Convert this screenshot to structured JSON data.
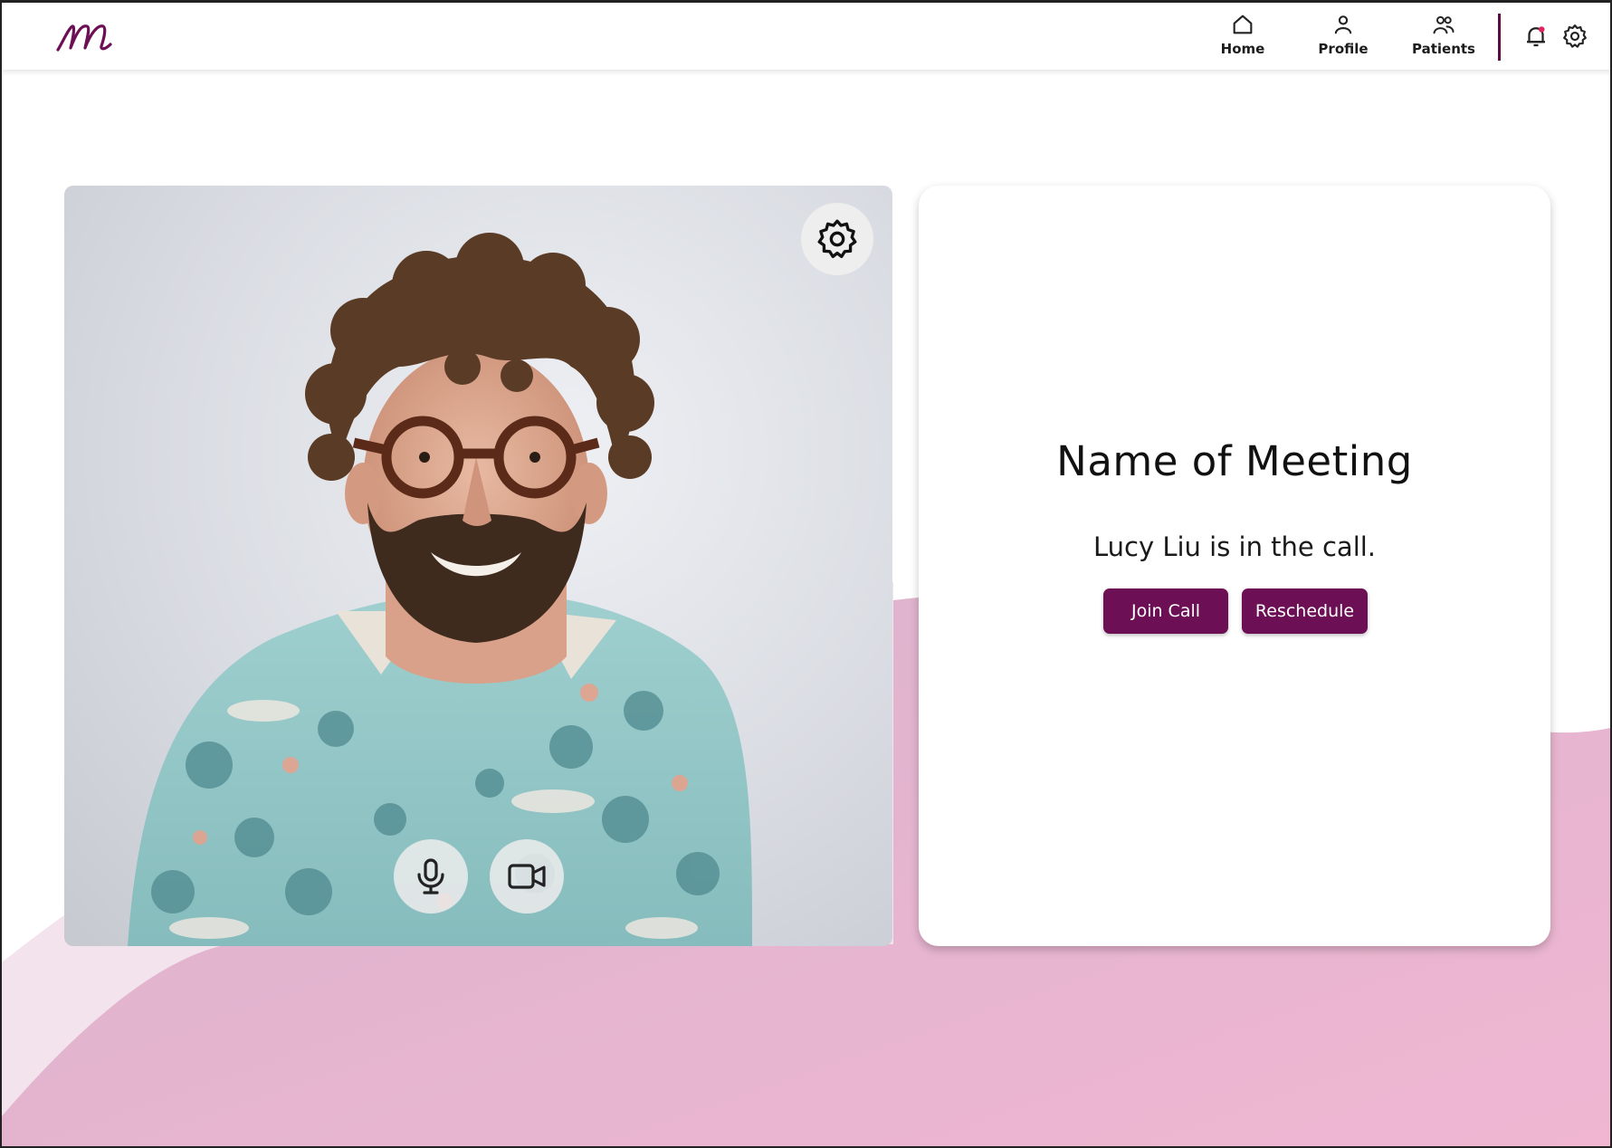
{
  "nav": {
    "items": [
      {
        "label": "Home",
        "icon": "home-icon"
      },
      {
        "label": "Profile",
        "icon": "person-icon"
      },
      {
        "label": "Patients",
        "icon": "people-icon"
      }
    ],
    "actions": [
      {
        "icon": "bell-icon"
      },
      {
        "icon": "gear-icon"
      }
    ]
  },
  "video": {
    "controls": [
      {
        "icon": "microphone-icon"
      },
      {
        "icon": "video-camera-icon"
      }
    ],
    "settings_icon": "gear-icon"
  },
  "meeting": {
    "title": "Name of Meeting",
    "status": "Lucy Liu is in the call.",
    "join_label": "Join Call",
    "reschedule_label": "Reschedule"
  },
  "colors": {
    "brand": "#6d0f55",
    "background_pink": "#e9b9d3",
    "notification_dot": "#e0245e"
  }
}
